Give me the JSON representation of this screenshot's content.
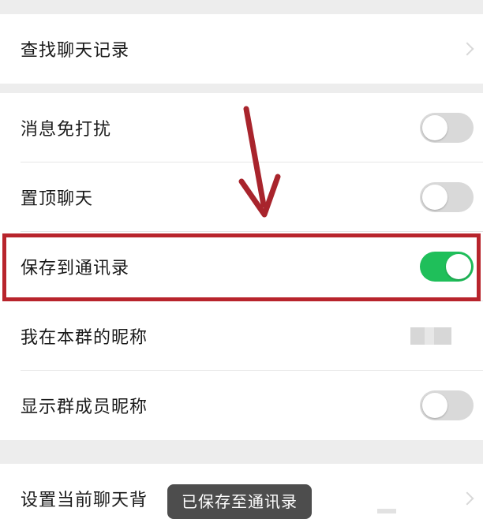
{
  "rows": {
    "search_history": "查找聊天记录",
    "do_not_disturb": "消息免打扰",
    "pin_chat": "置顶聊天",
    "save_to_contacts": "保存到通讯录",
    "my_group_nickname": "我在本群的昵称",
    "show_member_nicknames": "显示群成员昵称",
    "set_chat_background": "设置当前聊天背"
  },
  "toggles": {
    "do_not_disturb": false,
    "pin_chat": false,
    "save_to_contacts": true,
    "show_member_nicknames": false
  },
  "toast": {
    "message": "已保存至通讯录"
  },
  "colors": {
    "toggle_on": "#1fbf5a",
    "toggle_off": "#d9d9d9",
    "highlight_box": "#b8242c",
    "annotation_arrow": "#a8242c",
    "background": "#ededed"
  },
  "icons": {
    "chevron": "chevron-right-icon",
    "annotation": "annotation-arrow-icon"
  }
}
